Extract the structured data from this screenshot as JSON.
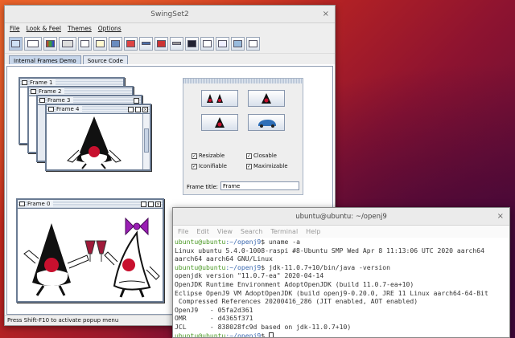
{
  "swing": {
    "title": "SwingSet2",
    "close": "×",
    "menus": [
      "File",
      "Look & Feel",
      "Themes",
      "Options"
    ],
    "tabs": [
      "Internal Frames Demo",
      "Source Code"
    ],
    "status": "Press Shift-F10 to activate popup menu"
  },
  "frames": [
    {
      "title": "Frame 1"
    },
    {
      "title": "Frame 2"
    },
    {
      "title": "Frame 3"
    },
    {
      "title": "Frame 4"
    },
    {
      "title": "Frame 0"
    }
  ],
  "panel": {
    "checkboxes": [
      "Resizable",
      "Closable",
      "Iconifiable",
      "Maximizable"
    ],
    "frame_title_label": "Frame title:",
    "frame_title_value": "Frame"
  },
  "terminal": {
    "title": "ubuntu@ubuntu: ~/openj9",
    "close": "×",
    "menus": [
      "File",
      "Edit",
      "View",
      "Search",
      "Terminal",
      "Help"
    ],
    "prompt_user": "ubuntu@ubuntu",
    "prompt_path": ":~/openj9",
    "cmd1": "$ uname -a",
    "out1a": "Linux ubuntu 5.4.0-1008-raspi #8-Ubuntu SMP Wed Apr 8 11:13:06 UTC 2020 aarch64",
    "out1b": "aarch64 aarch64 GNU/Linux",
    "cmd2": "$ jdk-11.0.7+10/bin/java -version",
    "out2a": "openjdk version \"11.0.7-ea\" 2020-04-14",
    "out2b": "OpenJDK Runtime Environment AdoptOpenJDK (build 11.0.7-ea+10)",
    "out2c": "Eclipse OpenJ9 VM AdoptOpenJDK (build openj9-0.20.0, JRE 11 Linux aarch64-64-Bit",
    "out2d": " Compressed References 20200416_286 (JIT enabled, AOT enabled)",
    "out2e": "OpenJ9   - 05fa2d361",
    "out2f": "OMR      - d4365f371",
    "out2g": "JCL      - 838028fc9d based on jdk-11.0.7+10)",
    "cmd3": "$ "
  }
}
